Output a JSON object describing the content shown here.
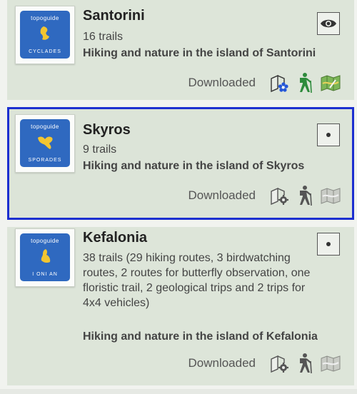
{
  "items": [
    {
      "title": "Santorini",
      "trails": "16 trails",
      "description": "Hiking and nature in the island of Santorini",
      "thumb_brand": "topoguide",
      "thumb_region": "CYCLADES",
      "status": "Downloaded",
      "toggle_icon": "eye-icon",
      "icons": [
        "flower-guide-icon",
        "hiker-icon",
        "map-icon"
      ],
      "icons_active": true
    },
    {
      "title": "Skyros",
      "trails": "9 trails",
      "description": "Hiking and nature in the island of Skyros",
      "thumb_brand": "topoguide",
      "thumb_region": "SPORADES",
      "status": "Downloaded",
      "toggle_icon": "dot-icon",
      "icons": [
        "settings-guide-icon",
        "hiker-icon",
        "map-icon"
      ],
      "icons_active": false
    },
    {
      "title": "Kefalonia",
      "trails": "38 trails (29 hiking routes, 3 birdwatching routes, 2 routes for butterfly observation, one floristic trail, 2 geological trips and 2 trips for 4x4 vehicles)",
      "description": "Hiking and nature in the island of Kefalonia",
      "thumb_brand": "topoguide",
      "thumb_region": "I ONI AN",
      "status": "Downloaded",
      "toggle_icon": "dot-icon",
      "icons": [
        "settings-guide-icon",
        "hiker-icon",
        "map-icon"
      ],
      "icons_active": false
    }
  ],
  "colors": {
    "selection_border": "#1c2fd0",
    "card_background": "#dde5d9",
    "thumb_tile": "#2f69c0",
    "island_shape": "#f2c531",
    "hiker_active": "#2e8b3c"
  }
}
